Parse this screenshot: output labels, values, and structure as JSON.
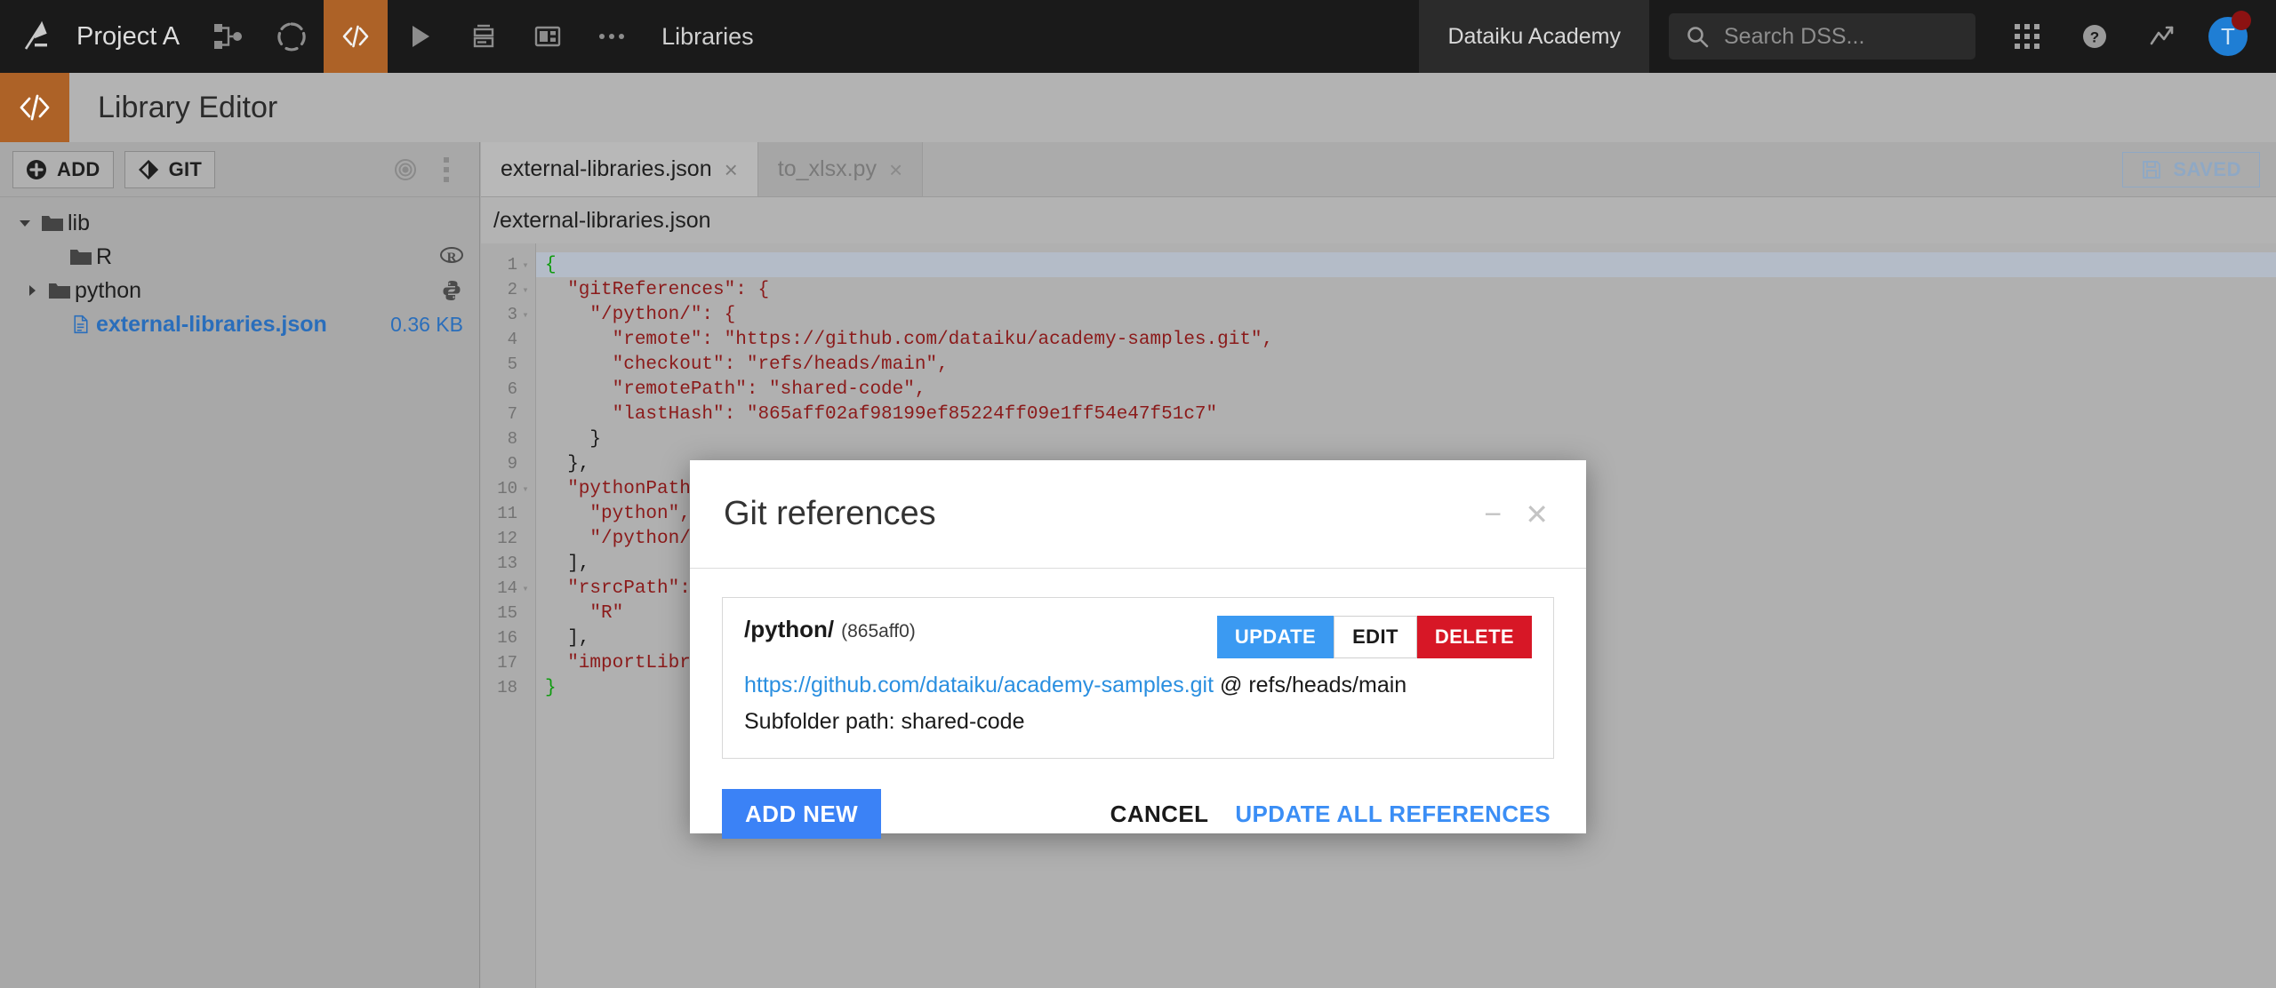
{
  "topbar": {
    "logo_icon": "dataiku-logo-icon",
    "project_name": "Project A",
    "nav_icons": [
      {
        "name": "flow-icon",
        "label": "Flow",
        "active": false
      },
      {
        "name": "lab-icon",
        "label": "Lab",
        "active": false
      },
      {
        "name": "code-icon",
        "label": "Code",
        "active": true
      },
      {
        "name": "jobs-play-icon",
        "label": "Jobs",
        "active": false
      },
      {
        "name": "notebooks-icon",
        "label": "Notebooks",
        "active": false
      },
      {
        "name": "dashboards-icon",
        "label": "Dashboards",
        "active": false
      }
    ],
    "more_icon": "more-horizontal-icon",
    "section_label": "Libraries",
    "academy_label": "Dataiku Academy",
    "search_icon": "search-icon",
    "search_placeholder": "Search DSS...",
    "apps_icon": "apps-grid-icon",
    "help_icon": "help-circle-icon",
    "trend_icon": "trend-up-icon",
    "avatar_initial": "T",
    "avatar_color": "#1f7ed4",
    "badge_color": "#8c1212",
    "accent_color": "#ad6227"
  },
  "pagehead": {
    "icon": "code-brackets-icon",
    "title": "Library Editor"
  },
  "sidebar": {
    "toolbar": {
      "add_label": "ADD",
      "add_icon": "plus-circle-icon",
      "git_label": "GIT",
      "git_icon": "git-icon",
      "target_icon": "target-icon",
      "more_icon": "more-vertical-icon"
    },
    "tree": [
      {
        "name": "tree-item-lib",
        "label": "lib",
        "icon": "folder-icon",
        "caret": "caret-down-icon",
        "depth": 0,
        "right": "",
        "right_icon": "",
        "type": "folder"
      },
      {
        "name": "tree-item-r",
        "label": "R",
        "icon": "folder-icon",
        "caret": "",
        "depth": 1,
        "right": "",
        "right_icon": "r-logo-icon",
        "type": "folder"
      },
      {
        "name": "tree-item-python",
        "label": "python",
        "icon": "folder-icon",
        "caret": "caret-right-icon",
        "depth": 1,
        "right": "",
        "right_icon": "python-logo-icon",
        "type": "folder"
      },
      {
        "name": "tree-item-external-libraries-json",
        "label": "external-libraries.json",
        "icon": "file-icon",
        "caret": "",
        "depth": 1,
        "right": "0.36 KB",
        "right_icon": "",
        "type": "file"
      }
    ]
  },
  "editor": {
    "tabs": [
      {
        "label": "external-libraries.json",
        "active": true,
        "close": "×"
      },
      {
        "label": "to_xlsx.py",
        "active": false,
        "close": "×"
      }
    ],
    "saved_label": "SAVED",
    "saved_icon": "floppy-disk-icon",
    "path": "/external-libraries.json",
    "current_line": 1,
    "lines": [
      {
        "n": "1",
        "fold": "▾",
        "text": "{"
      },
      {
        "n": "2",
        "fold": "▾",
        "text": "  \"gitReferences\": {"
      },
      {
        "n": "3",
        "fold": "▾",
        "text": "    \"/python/\": {"
      },
      {
        "n": "4",
        "fold": "",
        "text": "      \"remote\": \"https://github.com/dataiku/academy-samples.git\","
      },
      {
        "n": "5",
        "fold": "",
        "text": "      \"checkout\": \"refs/heads/main\","
      },
      {
        "n": "6",
        "fold": "",
        "text": "      \"remotePath\": \"shared-code\","
      },
      {
        "n": "7",
        "fold": "",
        "text": "      \"lastHash\": \"865aff02af98199ef85224ff09e1ff54e47f51c7\""
      },
      {
        "n": "8",
        "fold": "",
        "text": "    }"
      },
      {
        "n": "9",
        "fold": "",
        "text": "  },"
      },
      {
        "n": "10",
        "fold": "▾",
        "text": "  \"pythonPath\": ["
      },
      {
        "n": "11",
        "fold": "",
        "text": "    \"python\","
      },
      {
        "n": "12",
        "fold": "",
        "text": "    \"/python/\""
      },
      {
        "n": "13",
        "fold": "",
        "text": "  ],"
      },
      {
        "n": "14",
        "fold": "▾",
        "text": "  \"rsrcPath\": ["
      },
      {
        "n": "15",
        "fold": "",
        "text": "    \"R\""
      },
      {
        "n": "16",
        "fold": "",
        "text": "  ],"
      },
      {
        "n": "17",
        "fold": "",
        "text": "  \"importLibrariesFromProjects\": []"
      },
      {
        "n": "18",
        "fold": "",
        "text": "}"
      }
    ]
  },
  "modal": {
    "title": "Git references",
    "minimize_icon": "minimize-icon",
    "close_icon": "close-icon",
    "reference": {
      "path": "/python/",
      "hash": "(865aff0)",
      "update_label": "UPDATE",
      "edit_label": "EDIT",
      "delete_label": "DELETE",
      "remote_url": "https://github.com/dataiku/academy-samples.git",
      "branch_suffix": " @ refs/heads/main",
      "subfolder_line": "Subfolder path: shared-code"
    },
    "add_new_label": "ADD NEW",
    "cancel_label": "CANCEL",
    "update_all_label": "UPDATE ALL REFERENCES",
    "primary_color": "#3b82f6",
    "danger_color": "#d71726"
  }
}
